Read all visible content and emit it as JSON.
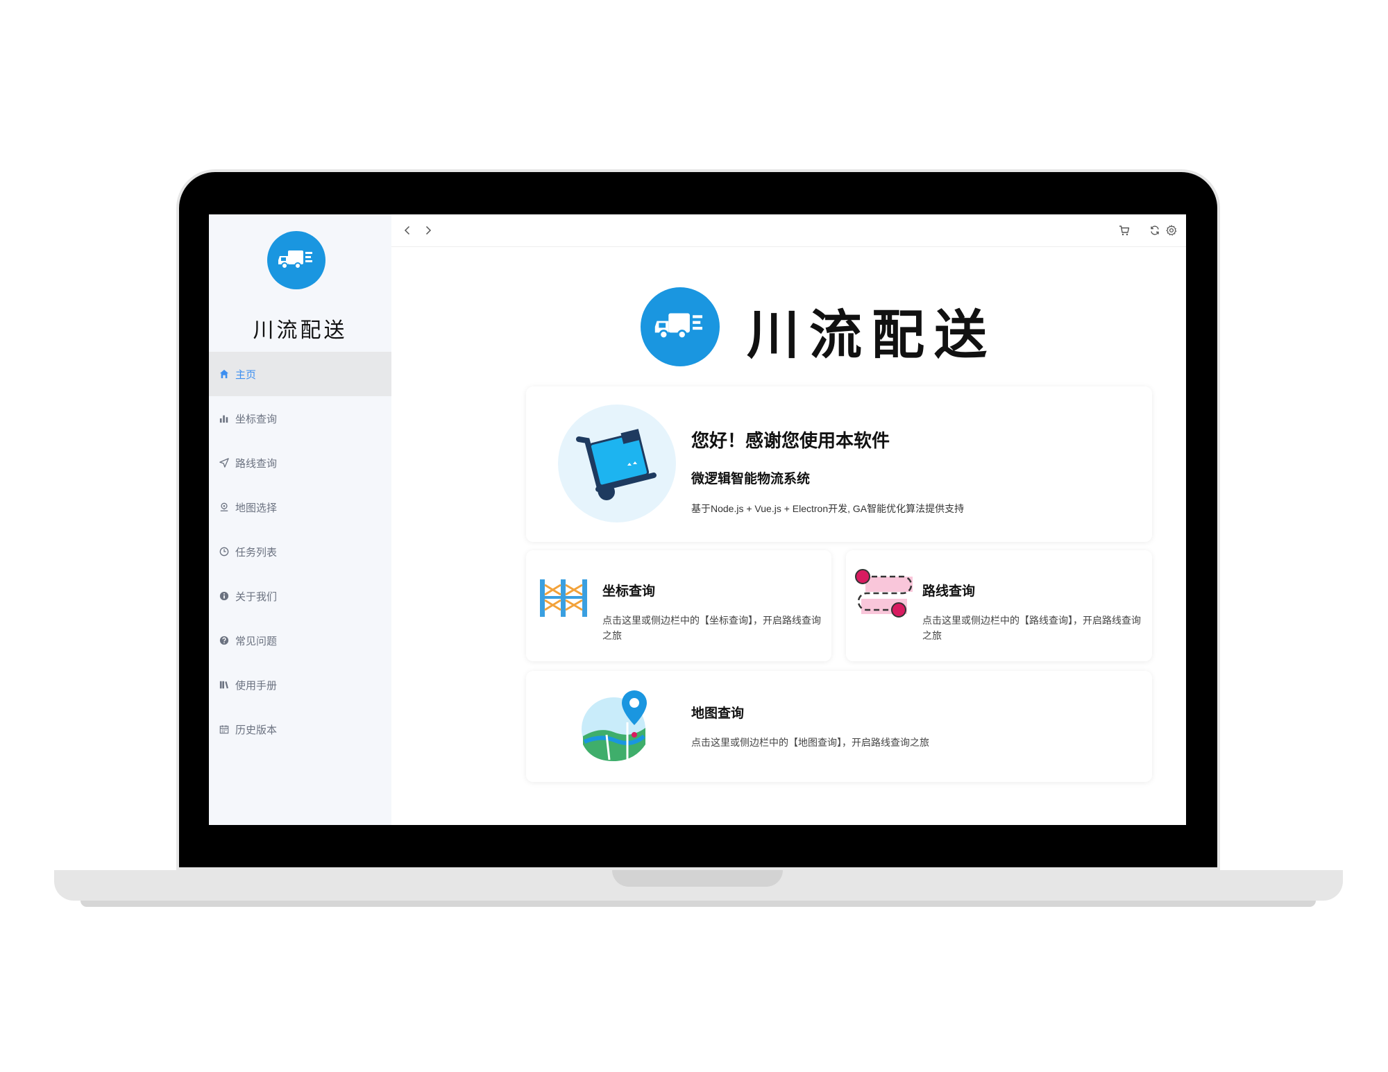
{
  "app": {
    "brand": "川流配送"
  },
  "sidebar": {
    "items": [
      {
        "label": "主页",
        "icon": "home-icon",
        "active": true
      },
      {
        "label": "坐标查询",
        "icon": "bar-chart-icon",
        "active": false
      },
      {
        "label": "路线查询",
        "icon": "navigation-icon",
        "active": false
      },
      {
        "label": "地图选择",
        "icon": "map-pin-icon",
        "active": false
      },
      {
        "label": "任务列表",
        "icon": "clock-icon",
        "active": false
      },
      {
        "label": "关于我们",
        "icon": "info-icon",
        "active": false
      },
      {
        "label": "常见问题",
        "icon": "question-icon",
        "active": false
      },
      {
        "label": "使用手册",
        "icon": "book-icon",
        "active": false
      },
      {
        "label": "历史版本",
        "icon": "calendar-icon",
        "active": false
      }
    ]
  },
  "topbar": {
    "back_icon": "chevron-left-icon",
    "forward_icon": "chevron-right-icon",
    "right_icons": [
      "cart-icon",
      "refresh-icon",
      "settings-icon"
    ]
  },
  "main": {
    "title": "川流配送",
    "welcome": {
      "heading": "您好！感谢您使用本软件",
      "subheading": "微逻辑智能物流系统",
      "description": "基于Node.js + Vue.js + Electron开发, GA智能优化算法提供支持"
    },
    "cards": {
      "coord": {
        "title": "坐标查询",
        "description": "点击这里或侧边栏中的【坐标查询】，开启路线查询之旅"
      },
      "route": {
        "title": "路线查询",
        "description": "点击这里或侧边栏中的【路线查询】，开启路线查询之旅"
      },
      "map": {
        "title": "地图查询",
        "description": "点击这里或侧边栏中的【地图查询】，开启路线查询之旅"
      }
    }
  },
  "colors": {
    "accent": "#3d8ff0",
    "brand_blue": "#1a96e0",
    "sidebar_bg": "#f5f7fb",
    "active_bg": "#e7e8ea"
  }
}
